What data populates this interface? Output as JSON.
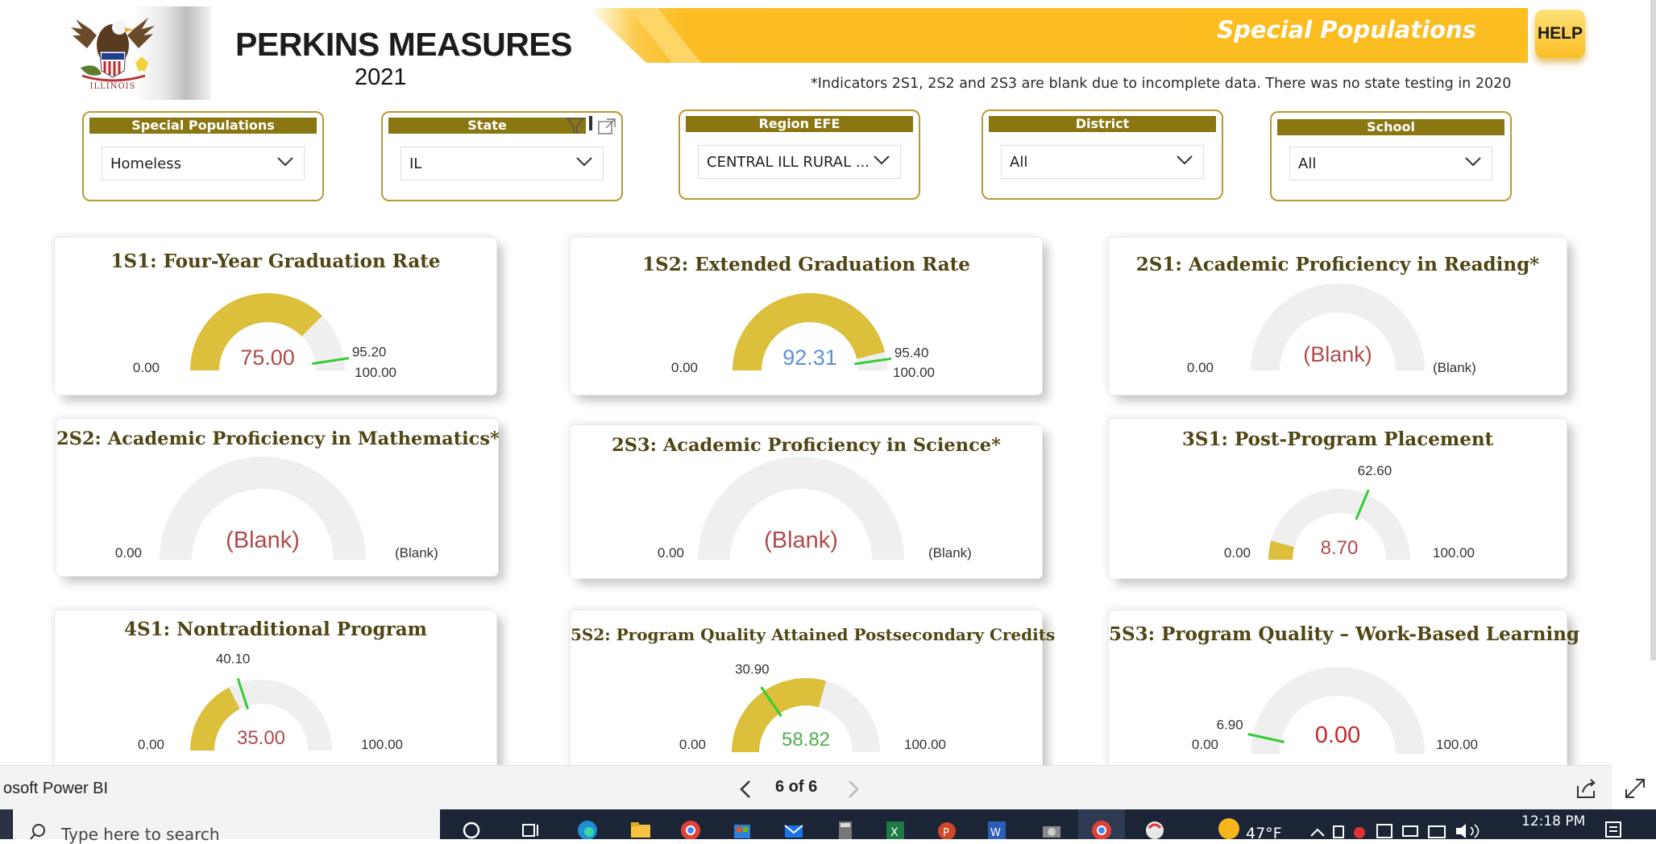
{
  "header": {
    "logo_text": "ILLINOIS",
    "title": "PERKINS MEASURES",
    "year": "2021",
    "banner_label": "Special Populations",
    "help_label": "HELP",
    "note": "*Indicators 2S1, 2S2 and 2S3 are blank due to incomplete data. There was no state testing in 2020"
  },
  "filters": [
    {
      "label": "Special Populations",
      "value": "Homeless"
    },
    {
      "label": "State",
      "value": "IL"
    },
    {
      "label": "Region EFE",
      "value": "CENTRAL ILL RURAL ..."
    },
    {
      "label": "District",
      "value": "All"
    },
    {
      "label": "School",
      "value": "All"
    }
  ],
  "cards": [
    {
      "title": "1S1: Four-Year Graduation Rate",
      "value": 75.0,
      "value_text": "75.00",
      "target": 95.2,
      "target_text": "95.20",
      "min_text": "0.00",
      "max_text": "100.00",
      "value_color": "#b04a4a"
    },
    {
      "title": "1S2: Extended Graduation Rate",
      "value": 92.31,
      "value_text": "92.31",
      "target": 95.4,
      "target_text": "95.40",
      "min_text": "0.00",
      "max_text": "100.00",
      "value_color": "#5b8fd9"
    },
    {
      "title": "2S1: Academic Proficiency in Reading*",
      "value": null,
      "value_text": "(Blank)",
      "target": null,
      "target_text": "",
      "min_text": "0.00",
      "max_text": "(Blank)",
      "value_color": "#b04a4a"
    },
    {
      "title": "2S2: Academic Proficiency in Mathematics*",
      "value": null,
      "value_text": "(Blank)",
      "target": null,
      "target_text": "",
      "min_text": "0.00",
      "max_text": "(Blank)",
      "value_color": "#b04a4a"
    },
    {
      "title": "2S3: Academic Proficiency in Science*",
      "value": null,
      "value_text": "(Blank)",
      "target": null,
      "target_text": "",
      "min_text": "0.00",
      "max_text": "(Blank)",
      "value_color": "#b04a4a"
    },
    {
      "title": "3S1: Post-Program Placement",
      "value": 8.7,
      "value_text": "8.70",
      "target": 62.6,
      "target_text": "62.60",
      "min_text": "0.00",
      "max_text": "100.00",
      "value_color": "#b04a4a"
    },
    {
      "title": "4S1: Nontraditional Program",
      "value": 35.0,
      "value_text": "35.00",
      "target": 40.1,
      "target_text": "40.10",
      "min_text": "0.00",
      "max_text": "100.00",
      "value_color": "#b04a4a"
    },
    {
      "title": "5S2: Program Quality Attained Postsecondary Credits",
      "value": 58.82,
      "value_text": "58.82",
      "target": 30.9,
      "target_text": "30.90",
      "min_text": "0.00",
      "max_text": "100.00",
      "value_color": "#4caf50"
    },
    {
      "title": "5S3: Program Quality – Work-Based Learning",
      "value": 0.0,
      "value_text": "0.00",
      "target": 6.9,
      "target_text": "6.90",
      "min_text": "0.00",
      "max_text": "100.00",
      "value_color": "#c62828"
    }
  ],
  "colors": {
    "gauge_fill": "#dcbf3b",
    "gauge_track": "#efefef",
    "target_line": "#33cc33",
    "accent": "#fbbd23",
    "slicer_header": "#8a7711"
  },
  "footer": {
    "app_name": "osoft Power BI",
    "page_indicator": "6 of 6"
  },
  "taskbar": {
    "search_placeholder": "Type here to search",
    "temperature": "47°F",
    "time": "12:18 PM"
  }
}
